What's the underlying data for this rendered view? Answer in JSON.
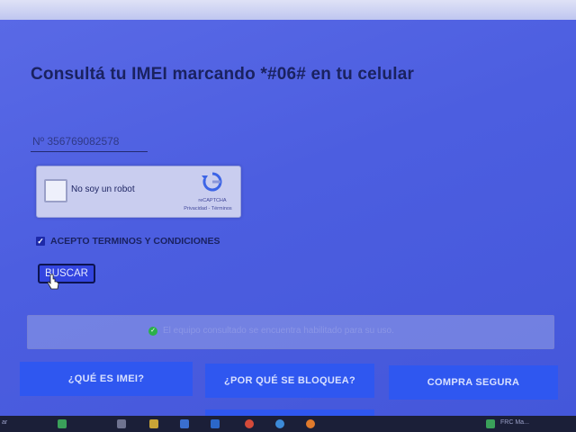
{
  "page": {
    "heading": "Consultá tu IMEI marcando *#06# en tu celular"
  },
  "form": {
    "imei_placeholder": "Nº 356769082578",
    "recaptcha": {
      "label": "No soy un robot",
      "brand": "reCAPTCHA",
      "links": "Privacidad - Términos"
    },
    "terms": {
      "checked": true,
      "label": "ACEPTO TERMINOS Y CONDICIONES"
    },
    "search_button": "BUSCAR"
  },
  "status": {
    "message": "El equipo consultado se encuentra habilitado para su uso.",
    "color": "#2bb04a"
  },
  "nav": {
    "imei": "¿QUÉ ES IMEI?",
    "blocked": "¿POR QUÉ SE BLOQUEA?",
    "safe_purchase": "COMPRA SEGURA"
  },
  "taskbar": {
    "left_text": "ar",
    "right_text": "FRC Ma..."
  },
  "colors": {
    "accent": "#2f57f0",
    "heading": "#1a2260"
  }
}
